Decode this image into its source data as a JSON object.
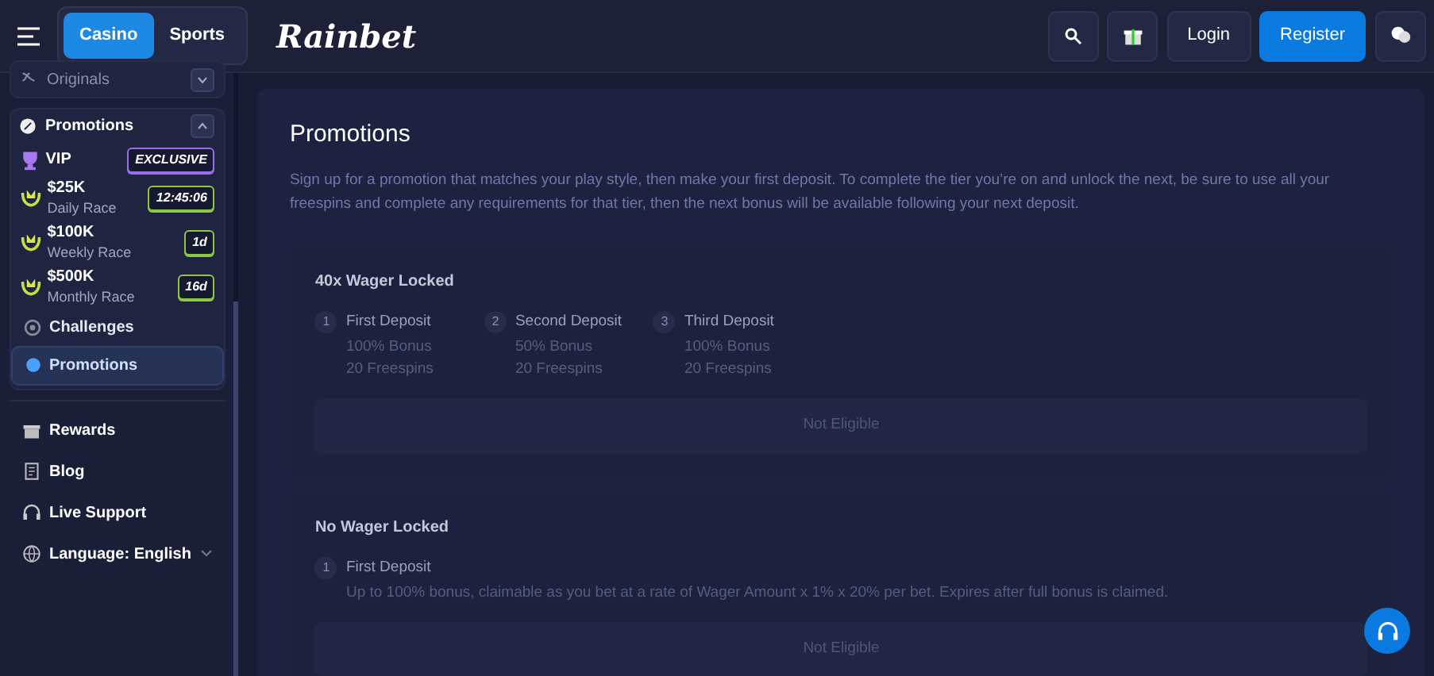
{
  "header": {
    "mode_tabs": [
      {
        "label": "Casino",
        "selected": true
      },
      {
        "label": "Sports",
        "selected": false
      }
    ],
    "logo": "Rainbet",
    "buttons": [
      {
        "label": "Login",
        "kind": "plain"
      },
      {
        "label": "Register",
        "kind": "primary"
      }
    ]
  },
  "sidebar": {
    "groups": [
      {
        "label": "Originals",
        "expanded": false
      },
      {
        "label": "Promotions",
        "expanded": true,
        "items": [
          {
            "kind": "vip",
            "title": "VIP",
            "tag": "EXCLUSIVE",
            "color": "#9b6cf0"
          },
          {
            "kind": "race",
            "title": "$25K",
            "subtitle": "Daily Race",
            "tag": "12:45:06",
            "color": "#8fc641"
          },
          {
            "kind": "race",
            "title": "$100K",
            "subtitle": "Weekly Race",
            "tag": "1d",
            "color": "#8fc641"
          },
          {
            "kind": "race",
            "title": "$500K",
            "subtitle": "Monthly Race",
            "tag": "16d",
            "color": "#8fc641"
          },
          {
            "kind": "link",
            "title": "Challenges",
            "selected": false
          },
          {
            "kind": "link",
            "title": "Promotions",
            "selected": true
          }
        ]
      }
    ],
    "links": [
      {
        "label": "Rewards",
        "kind": "gift"
      },
      {
        "label": "Blog",
        "kind": "doc"
      },
      {
        "label": "Live Support",
        "kind": "headset"
      },
      {
        "label": "Language: English",
        "kind": "globe"
      }
    ]
  },
  "main": {
    "title": "Promotions",
    "description": "Sign up for a promotion that matches your play style, then make your first deposit. To complete the tier you’re on and unlock the next, be sure to use all your freespins and complete any requirements for that tier, then the next bonus will be available following your next deposit.",
    "tiers": [
      {
        "title": "40x Wager Locked",
        "steps": [
          {
            "number": "1",
            "title": "First Deposit",
            "lines": [
              "100% Bonus",
              "20 Freespins"
            ]
          },
          {
            "number": "2",
            "title": "Second Deposit",
            "lines": [
              "50% Bonus",
              "20 Freespins"
            ]
          },
          {
            "number": "3",
            "title": "Third Deposit",
            "lines": [
              "100% Bonus",
              "20 Freespins"
            ]
          }
        ],
        "status": "Not Eligible"
      },
      {
        "title": "No Wager Locked",
        "steps": [
          {
            "number": "1",
            "title": "First Deposit",
            "lines": [
              "Up to 100% bonus, claimable as you bet at a rate of Wager Amount x 1% x 20% per bet. Expires after full bonus is claimed."
            ]
          }
        ],
        "status": "Not Eligible"
      }
    ]
  }
}
